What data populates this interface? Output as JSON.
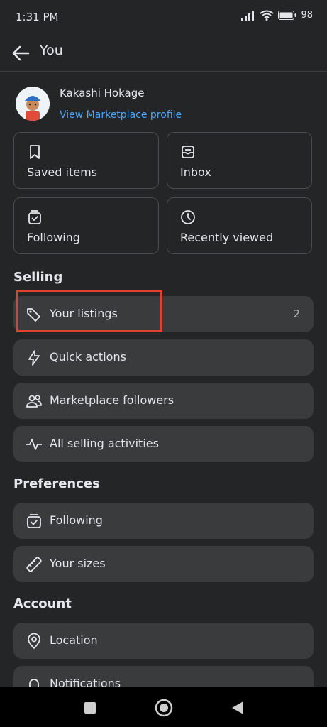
{
  "status_bar": {
    "time": "1:31 PM",
    "battery": "98"
  },
  "header": {
    "title": "You"
  },
  "profile": {
    "name": "Kakashi Hokage",
    "link": "View Marketplace profile"
  },
  "tiles": [
    {
      "label": "Saved items",
      "icon": "bookmark-icon"
    },
    {
      "label": "Inbox",
      "icon": "inbox-icon"
    },
    {
      "label": "Following",
      "icon": "following-bag-icon"
    },
    {
      "label": "Recently viewed",
      "icon": "clock-icon"
    }
  ],
  "selling": {
    "heading": "Selling",
    "items": [
      {
        "label": "Your listings",
        "count": "2",
        "icon": "tag-icon"
      },
      {
        "label": "Quick actions",
        "icon": "lightning-icon"
      },
      {
        "label": "Marketplace followers",
        "icon": "people-icon"
      },
      {
        "label": "All selling activities",
        "icon": "activity-pulse-icon"
      }
    ]
  },
  "preferences": {
    "heading": "Preferences",
    "items": [
      {
        "label": "Following",
        "icon": "following-bag-icon"
      },
      {
        "label": "Your sizes",
        "icon": "ruler-icon"
      }
    ]
  },
  "account": {
    "heading": "Account",
    "items": [
      {
        "label": "Location",
        "icon": "location-pin-icon"
      },
      {
        "label": "Notifications",
        "icon": "bell-icon"
      }
    ]
  },
  "colors": {
    "background": "#242526",
    "card": "#3a3b3c",
    "link": "#4ea3f5",
    "highlight": "#e0432b"
  }
}
